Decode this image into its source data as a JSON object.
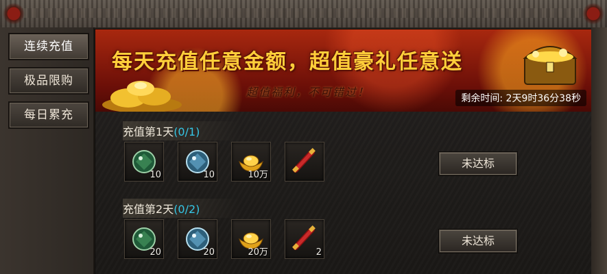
{
  "sidebar": {
    "items": [
      {
        "label": "连续充值",
        "active": true
      },
      {
        "label": "极品限购",
        "active": false
      },
      {
        "label": "每日累充",
        "active": false
      }
    ]
  },
  "banner": {
    "title": "每天充值任意金额，超值豪礼任意送",
    "subtitle": "超值福利，不可错过！",
    "timer_label": "剩余时间:",
    "timer_value": "2天9时36分38秒"
  },
  "rewards": [
    {
      "title": "充值第1天",
      "progress": "(0/1)",
      "button_label": "未达标",
      "items": [
        {
          "icon": "green-gem-icon",
          "count": "10"
        },
        {
          "icon": "blue-gem-icon",
          "count": "10"
        },
        {
          "icon": "gold-ingot-icon",
          "count": "10万"
        },
        {
          "icon": "red-scroll-icon",
          "count": ""
        }
      ]
    },
    {
      "title": "充值第2天",
      "progress": "(0/2)",
      "button_label": "未达标",
      "items": [
        {
          "icon": "green-gem-icon",
          "count": "20"
        },
        {
          "icon": "blue-gem-icon",
          "count": "20"
        },
        {
          "icon": "gold-ingot-icon",
          "count": "20万"
        },
        {
          "icon": "red-scroll-icon",
          "count": "2"
        }
      ]
    }
  ],
  "colors": {
    "progress": "#35c6e6",
    "banner_title": "#ffcf3a",
    "banner_bg": "#a8280f"
  }
}
